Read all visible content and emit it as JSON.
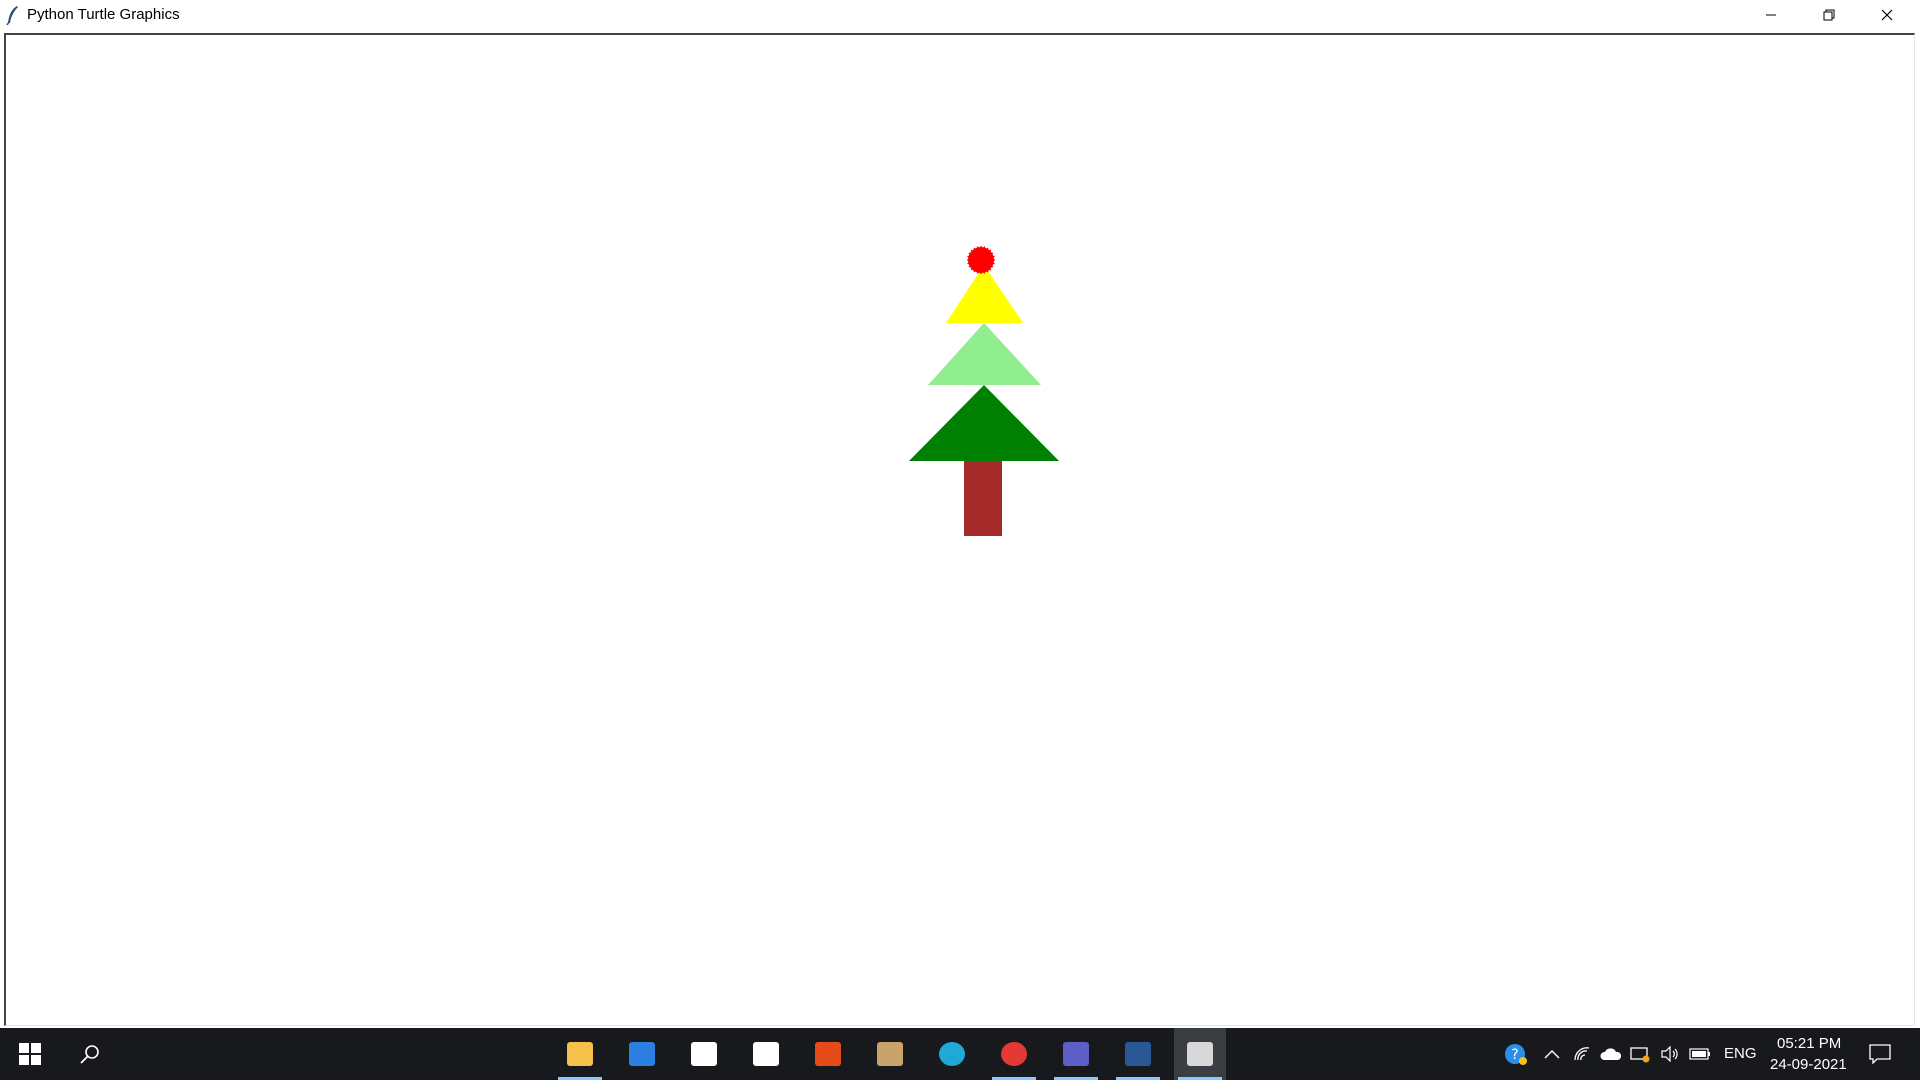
{
  "window": {
    "title": "Python Turtle Graphics"
  },
  "drawing": {
    "colors": {
      "star": "#ff0000",
      "tier_top": "#ffff00",
      "tier_middle": "#90ee90",
      "tier_bottom": "#008000",
      "trunk": "#a52a2a"
    }
  },
  "taskbar": {
    "apps": [
      {
        "name": "file-explorer-icon",
        "color": "#f5c14b"
      },
      {
        "name": "mail-icon",
        "color": "#2b7fe0"
      },
      {
        "name": "dropbox-icon",
        "color": "#ffffff"
      },
      {
        "name": "winamp-icon",
        "color": "#ffffff"
      },
      {
        "name": "office-icon",
        "color": "#e64a19"
      },
      {
        "name": "package-icon",
        "color": "#c9a36b"
      },
      {
        "name": "edge-icon",
        "color": "#1fa9d6"
      },
      {
        "name": "chrome-icon",
        "color": "#e53935"
      },
      {
        "name": "teams-icon",
        "color": "#5b5fc7"
      },
      {
        "name": "word-icon",
        "color": "#2b5797"
      },
      {
        "name": "python-turtle-icon",
        "color": "#d8d8d8"
      }
    ],
    "tray": {
      "language": "ENG",
      "time": "05:21 PM",
      "date": "24-09-2021"
    }
  }
}
